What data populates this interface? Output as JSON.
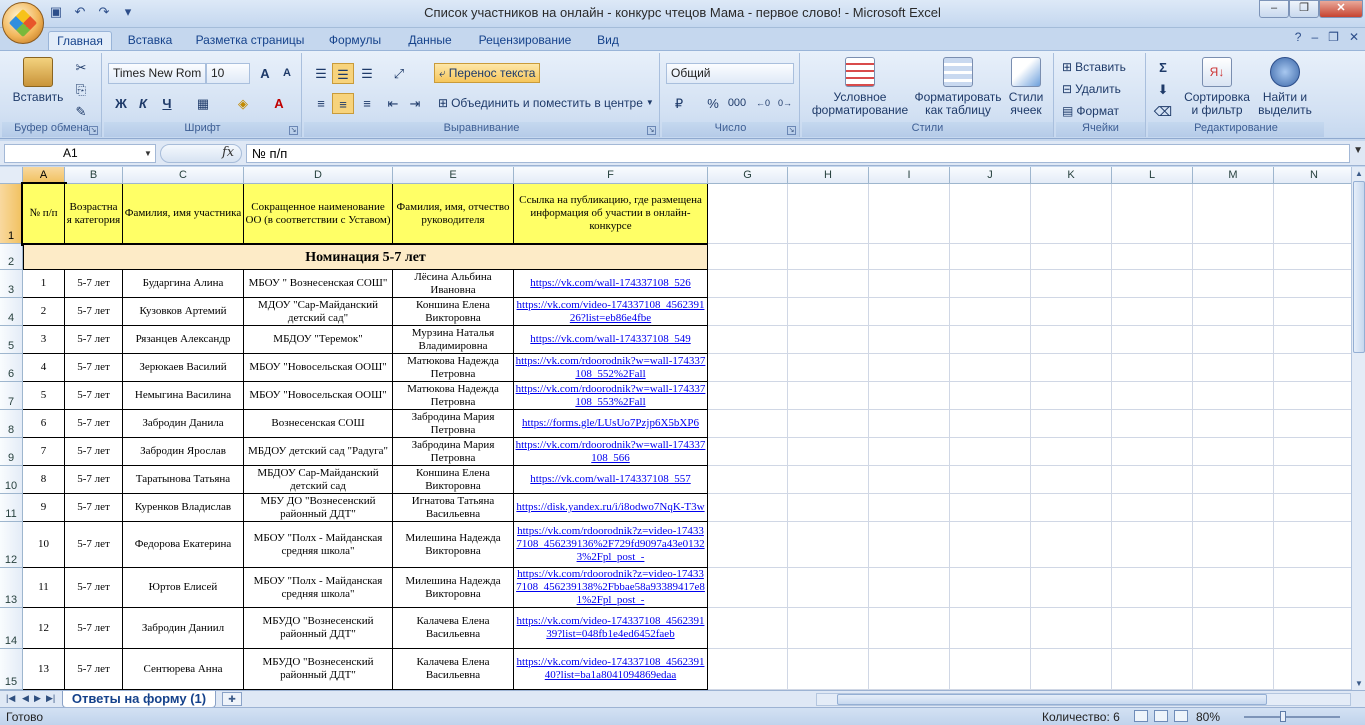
{
  "window": {
    "title": "Список участников на онлайн - конкурс чтецов Мама - первое слово! - Microsoft Excel"
  },
  "qat": {
    "save_icon": "save-icon",
    "undo_icon": "undo-icon",
    "redo_icon": "redo-icon",
    "customize_icon": "customize-icon"
  },
  "tabs": [
    "Главная",
    "Вставка",
    "Разметка страницы",
    "Формулы",
    "Данные",
    "Рецензирование",
    "Вид"
  ],
  "ribbon": {
    "clipboard": {
      "label": "Буфер обмена",
      "paste": "Вставить"
    },
    "font": {
      "label": "Шрифт",
      "name": "Times New Rom",
      "size": "10",
      "bold": "Ж",
      "italic": "К",
      "underline": "Ч"
    },
    "alignment": {
      "label": "Выравнивание",
      "wrap": "Перенос текста",
      "merge": "Объединить и поместить в центре"
    },
    "number": {
      "label": "Число",
      "format": "Общий",
      "percent": "%",
      "thousands": "000"
    },
    "styles": {
      "label": "Стили",
      "conditional": [
        "Условное",
        "форматирование"
      ],
      "table": [
        "Форматировать",
        "как таблицу"
      ],
      "cell_styles": [
        "Стили",
        "ячеек"
      ]
    },
    "cells": {
      "label": "Ячейки",
      "insert": "Вставить",
      "delete": "Удалить",
      "format": "Формат"
    },
    "editing": {
      "label": "Редактирование",
      "sort": [
        "Сортировка",
        "и фильтр"
      ],
      "find": [
        "Найти и",
        "выделить"
      ]
    }
  },
  "formula_bar": {
    "name_box": "A1",
    "fx": "fx",
    "formula": "№ п/п"
  },
  "columns": [
    "A",
    "B",
    "C",
    "D",
    "E",
    "F",
    "G",
    "H",
    "I",
    "J",
    "K",
    "L",
    "M",
    "N"
  ],
  "row_numbers": [
    "1",
    "2",
    "3",
    "4",
    "5",
    "6",
    "7",
    "8",
    "9",
    "10",
    "11",
    "12",
    "13",
    "14",
    "15"
  ],
  "header_row": [
    "№ п/п",
    "Возрастна я категория",
    "Фамилия, имя участника",
    "Сокращенное наименование ОО (в соответствии с Уставом)",
    "Фамилия, имя, отчество руководителя",
    "Ссылка на публикацию, где  размещена информация об участии в онлайн-конкурсе"
  ],
  "nomination": "Номинация 5-7 лет",
  "rows": [
    [
      "1",
      "5-7 лет",
      "Бударгина Алина",
      "МБОУ \" Вознесенская СОШ\"",
      "Лёсина Альбина Ивановна",
      "https://vk.com/wall-174337108_526"
    ],
    [
      "2",
      "5-7 лет",
      "Кузовков Артемий",
      "МДОУ \"Сар-Майданский детский сад\"",
      "Коншина Елена Викторовна",
      "https://vk.com/video-174337108_456239126?list=eb86e4fbe"
    ],
    [
      "3",
      "5-7 лет",
      "Рязанцев Александр",
      "МБДОУ \"Теремок\"",
      "Мурзина Наталья Владимировна",
      "https://vk.com/wall-174337108_549"
    ],
    [
      "4",
      "5-7 лет",
      "Зерюкаев Василий",
      "МБОУ \"Новосельская ООШ\"",
      "Матюкова Надежда Петровна",
      "https://vk.com/rdoorodnik?w=wall-174337108_552%2Fall"
    ],
    [
      "5",
      "5-7 лет",
      "Немыгина Василина",
      "МБОУ \"Новосельская ООШ\"",
      "Матюкова Надежда Петровна",
      "https://vk.com/rdoorodnik?w=wall-174337108_553%2Fall"
    ],
    [
      "6",
      "5-7 лет",
      "Забродин Данила",
      "Вознесенская СОШ",
      "Забродина Мария Петровна",
      "https://forms.gle/LUsUo7Pzjp6X5bXP6"
    ],
    [
      "7",
      "5-7 лет",
      "Забродин Ярослав",
      "МБДОУ детский сад \"Радуга\"",
      "Забродина Мария Петровна",
      "https://vk.com/rdoorodnik?w=wall-174337108_566"
    ],
    [
      "8",
      "5-7 лет",
      "Таратынова Татьяна",
      "МБДОУ Сар-Майданский детский сад",
      "Коншина Елена Викторовна",
      "https://vk.com/wall-174337108_557"
    ],
    [
      "9",
      "5-7 лет",
      "Куренков Владислав",
      "МБУ ДО \"Вознесенский районный ДДТ\"",
      "Игнатова Татьяна Васильевна",
      "https://disk.yandex.ru/i/i8odwo7NqK-T3w"
    ],
    [
      "10",
      "5-7 лет",
      "Федорова Екатерина",
      "МБОУ \"Полх - Майданская средняя школа\"",
      "Милешина Надежда Викторовна",
      "https://vk.com/rdoorodnik?z=video-174337108_456239136%2F729fd9097a43e01323%2Fpl_post_-"
    ],
    [
      "11",
      "5-7 лет",
      "Юртов Елисей",
      "МБОУ \"Полх - Майданская средняя школа\"",
      "Милешина Надежда Викторовна",
      "https://vk.com/rdoorodnik?z=video-174337108_456239138%2Fbbae58a93389417e81%2Fpl_post_-"
    ],
    [
      "12",
      "5-7 лет",
      "Забродин Даниил",
      "МБУДО \"Вознесенский районный ДДТ\"",
      "Калачева Елена Васильевна",
      "https://vk.com/video-174337108_456239139?list=048fb1e4ed6452faeb"
    ],
    [
      "13",
      "5-7 лет",
      "Сентюрева Анна",
      "МБУДО \"Вознесенский районный  ДДТ\"",
      "Калачева Елена Васильевна",
      "https://vk.com/video-174337108_456239140?list=ba1a8041094869edaa"
    ]
  ],
  "sheet_tab": "Ответы на форму (1)",
  "status": {
    "ready": "Готово",
    "count": "Количество: 6",
    "zoom": "80%"
  },
  "colors": {
    "header_fill": "#ffff66",
    "nomination_fill": "#fdebc7",
    "link": "#0000ee"
  }
}
